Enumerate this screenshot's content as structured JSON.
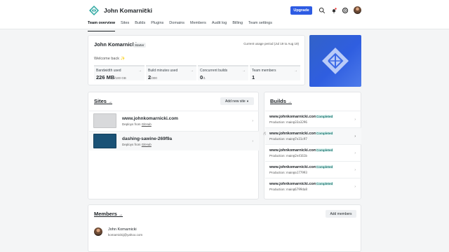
{
  "header": {
    "team_name": "John Komarnicki",
    "upgrade_label": "Upgrade",
    "icons": [
      "netlify-logo-icon",
      "search-icon",
      "bell-icon",
      "help-icon",
      "avatar"
    ]
  },
  "nav": [
    {
      "label": "Team overview",
      "active": true
    },
    {
      "label": "Sites"
    },
    {
      "label": "Builds"
    },
    {
      "label": "Plugins"
    },
    {
      "label": "Domains"
    },
    {
      "label": "Members"
    },
    {
      "label": "Audit log"
    },
    {
      "label": "Billing"
    },
    {
      "label": "Team settings"
    }
  ],
  "overview": {
    "title": "John Komarnicki",
    "plan_badge": "Starter",
    "usage_period": "Current usage period (Jul 19 to Aug 19)",
    "welcome": "Welcome back ✨",
    "stats": [
      {
        "label": "Bandwidth used",
        "value": "226 MB",
        "suffix": "/100 GB"
      },
      {
        "label": "Build minutes used",
        "value": "2",
        "suffix": "/300"
      },
      {
        "label": "Concurrent builds",
        "value": "0",
        "suffix": "/1"
      },
      {
        "label": "Team members",
        "value": "1",
        "suffix": ""
      }
    ]
  },
  "sites": {
    "title": "Sites",
    "add_button": "Add new site",
    "items": [
      {
        "name": "www.johnkomarnicki.com",
        "deploy_text": "Deploys from",
        "deploy_source": "GitHub"
      },
      {
        "name": "dashing-sawine-269f9a",
        "deploy_text": "Deploys from",
        "deploy_source": "GitHub"
      }
    ]
  },
  "builds": {
    "title": "Builds",
    "items": [
      {
        "site": "www.johnkomarnicki.com",
        "status": "Completed",
        "branch": "Production: main",
        "commit": "@33a3296"
      },
      {
        "site": "www.johnkomarnicki.com",
        "status": "Completed",
        "branch": "Production: main",
        "commit": "@7e31c97"
      },
      {
        "site": "www.johnkomarnicki.com",
        "status": "Completed",
        "branch": "Production: main",
        "commit": "@2e4161b"
      },
      {
        "site": "www.johnkomarnicki.com",
        "status": "Completed",
        "branch": "Production: main",
        "commit": "@a177993"
      },
      {
        "site": "www.johnkomarnicki.com",
        "status": "Completed",
        "branch": "Production: main",
        "commit": "@6799da8"
      }
    ]
  },
  "members": {
    "title": "Members",
    "add_button": "Add members",
    "items": [
      {
        "name": "John Komarnicki",
        "email": "komarnickij@yahoo.com"
      }
    ]
  },
  "colors": {
    "accent": "#2d5be3",
    "status_green": "#15716b"
  }
}
